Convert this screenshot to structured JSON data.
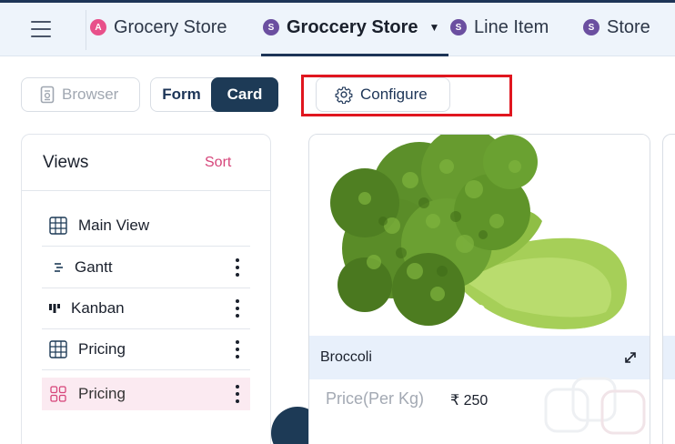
{
  "tabs": [
    {
      "badge": "A",
      "badge_color": "#e8508a",
      "label": "Grocery Store"
    },
    {
      "badge": "S",
      "badge_color": "#6b4fa0",
      "label": "Groccery Store",
      "active": true
    },
    {
      "badge": "S",
      "badge_color": "#6b4fa0",
      "label": "Line Item"
    },
    {
      "badge": "S",
      "badge_color": "#6b4fa0",
      "label": "Store"
    }
  ],
  "toolbar": {
    "browser_label": "Browser",
    "form_label": "Form",
    "card_label": "Card",
    "configure_label": "Configure"
  },
  "views": {
    "title": "Views",
    "sort_label": "Sort",
    "items": [
      {
        "label": "Main View",
        "icon": "grid-icon"
      },
      {
        "label": "Gantt",
        "icon": "gantt-icon"
      },
      {
        "label": "Kanban",
        "icon": "kanban-icon"
      },
      {
        "label": "Pricing",
        "icon": "grid-icon"
      },
      {
        "label": "Pricing",
        "icon": "gallery-icon",
        "selected": true
      }
    ]
  },
  "card": {
    "title": "Broccoli",
    "price_label": "Price(Per Kg)",
    "price_value": "₹ 250"
  },
  "colors": {
    "accent": "#1d3a56",
    "sort": "#d6457a",
    "highlight": "#e0161f"
  }
}
